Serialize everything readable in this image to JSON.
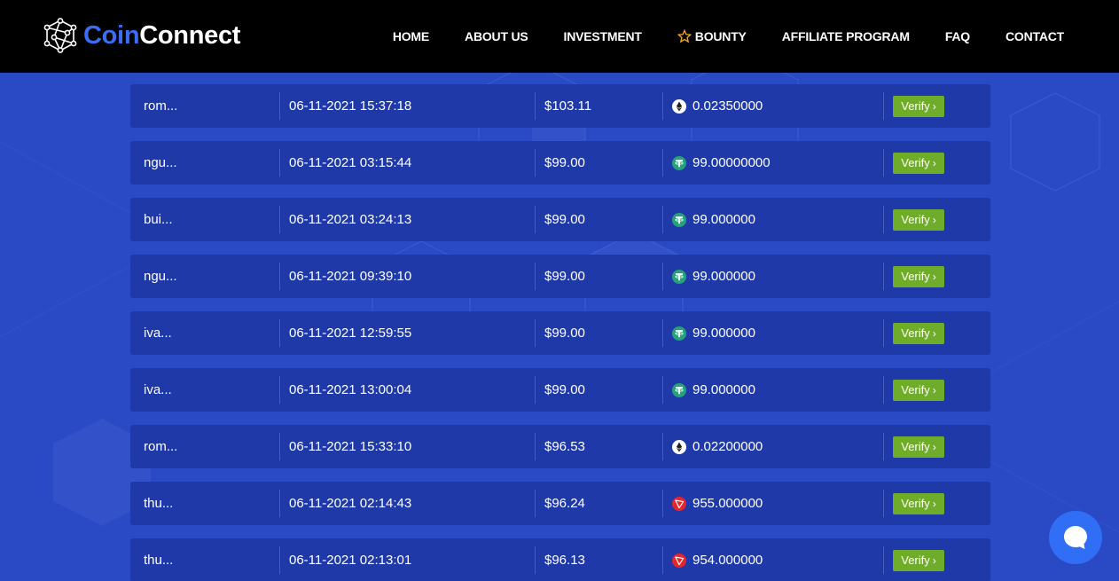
{
  "header": {
    "logo_coin": "Coin",
    "logo_connect": "Connect",
    "nav": [
      {
        "label": "HOME",
        "icon": null
      },
      {
        "label": "ABOUT US",
        "icon": null
      },
      {
        "label": "INVESTMENT",
        "icon": null
      },
      {
        "label": "BOUNTY",
        "icon": "star-icon"
      },
      {
        "label": "AFFILIATE PROGRAM",
        "icon": null
      },
      {
        "label": "FAQ",
        "icon": null
      },
      {
        "label": "CONTACT",
        "icon": null
      }
    ]
  },
  "colors": {
    "accent": "#3c6cf0",
    "background": "#2a49c4",
    "row": "#1f3aa8",
    "verify": "#6fac29",
    "star": "#f5a623"
  },
  "transactions": [
    {
      "user": "rom...",
      "date": "06-11-2021 15:37:18",
      "amount": "$103.11",
      "coin": "eth",
      "crypto_amount": "0.02350000",
      "verify": "Verify"
    },
    {
      "user": "ngu...",
      "date": "06-11-2021 03:15:44",
      "amount": "$99.00",
      "coin": "usdt",
      "crypto_amount": "99.00000000",
      "verify": "Verify"
    },
    {
      "user": "bui...",
      "date": "06-11-2021 03:24:13",
      "amount": "$99.00",
      "coin": "usdt",
      "crypto_amount": "99.000000",
      "verify": "Verify"
    },
    {
      "user": "ngu...",
      "date": "06-11-2021 09:39:10",
      "amount": "$99.00",
      "coin": "usdt",
      "crypto_amount": "99.000000",
      "verify": "Verify"
    },
    {
      "user": "iva...",
      "date": "06-11-2021 12:59:55",
      "amount": "$99.00",
      "coin": "usdt",
      "crypto_amount": "99.000000",
      "verify": "Verify"
    },
    {
      "user": "iva...",
      "date": "06-11-2021 13:00:04",
      "amount": "$99.00",
      "coin": "usdt",
      "crypto_amount": "99.000000",
      "verify": "Verify"
    },
    {
      "user": "rom...",
      "date": "06-11-2021 15:33:10",
      "amount": "$96.53",
      "coin": "eth",
      "crypto_amount": "0.02200000",
      "verify": "Verify"
    },
    {
      "user": "thu...",
      "date": "06-11-2021 02:14:43",
      "amount": "$96.24",
      "coin": "trx",
      "crypto_amount": "955.000000",
      "verify": "Verify"
    },
    {
      "user": "thu...",
      "date": "06-11-2021 02:13:01",
      "amount": "$96.13",
      "coin": "trx",
      "crypto_amount": "954.000000",
      "verify": "Verify"
    }
  ],
  "chat": {
    "icon": "chat-bubble-icon"
  }
}
